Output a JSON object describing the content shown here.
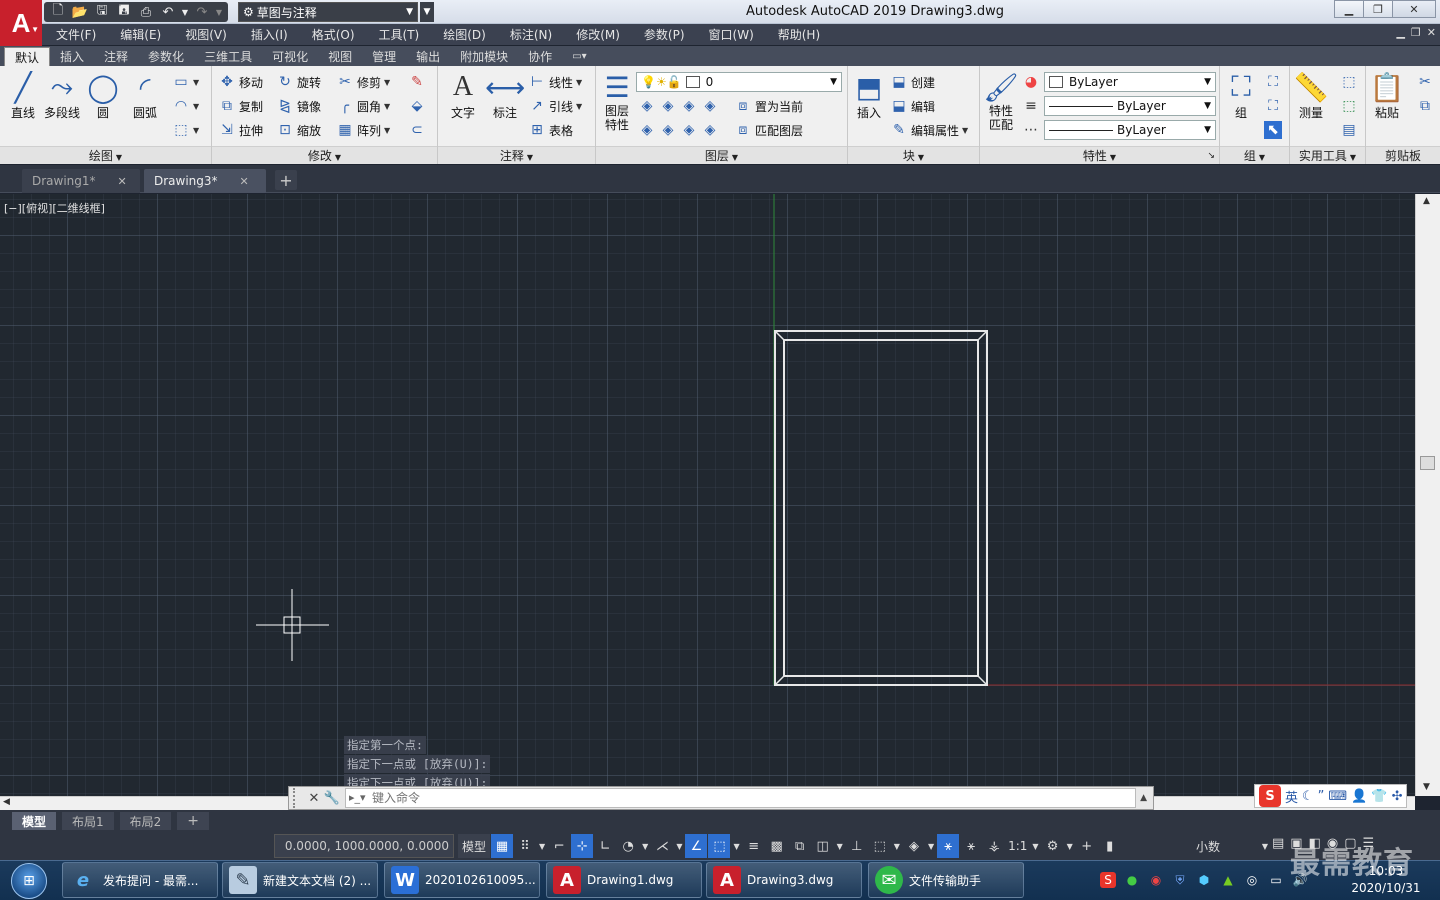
{
  "app": {
    "window_title": "Autodesk AutoCAD 2019    Drawing3.dwg",
    "logo_letter": "A",
    "workspace": "草图与注释"
  },
  "menu": [
    "文件(F)",
    "编辑(E)",
    "视图(V)",
    "插入(I)",
    "格式(O)",
    "工具(T)",
    "绘图(D)",
    "标注(N)",
    "修改(M)",
    "参数(P)",
    "窗口(W)",
    "帮助(H)"
  ],
  "ribbon_tabs": [
    "默认",
    "插入",
    "注释",
    "参数化",
    "三维工具",
    "可视化",
    "视图",
    "管理",
    "输出",
    "附加模块",
    "协作"
  ],
  "ribbon": {
    "draw": {
      "title": "绘图",
      "line": "直线",
      "polyline": "多段线",
      "circle": "圆",
      "arc": "圆弧"
    },
    "modify": {
      "title": "修改",
      "move": "移动",
      "rotate": "旋转",
      "trim": "修剪",
      "copy": "复制",
      "mirror": "镜像",
      "fillet": "圆角",
      "stretch": "拉伸",
      "scale": "缩放",
      "array": "阵列"
    },
    "annotation": {
      "title": "注释",
      "text": "文字",
      "dimension": "标注",
      "linear": "线性",
      "leader": "引线",
      "table": "表格"
    },
    "layers": {
      "title": "图层",
      "props_l1": "图层",
      "props_l2": "特性",
      "current_layer": "0",
      "set_current": "置为当前",
      "match_layer": "匹配图层"
    },
    "block": {
      "title": "块",
      "insert": "插入",
      "create": "创建",
      "edit": "编辑",
      "edit_attr": "编辑属性"
    },
    "properties": {
      "title": "特性",
      "match_l1": "特性",
      "match_l2": "匹配",
      "color": "ByLayer",
      "linetype": "ByLayer",
      "lineweight": "ByLayer"
    },
    "groups": {
      "title": "组",
      "group": "组"
    },
    "utilities": {
      "title": "实用工具",
      "measure": "测量"
    },
    "clipboard": {
      "title": "剪贴板",
      "paste": "粘贴"
    }
  },
  "file_tabs": [
    {
      "label": "Drawing1*"
    },
    {
      "label": "Drawing3*"
    }
  ],
  "viewport_label": "[−][俯视][二维线框]",
  "command_history": [
    "指定第一个点:",
    "指定下一点或 [放弃(U)]:",
    "指定下一点或 [放弃(U)]:"
  ],
  "command_placeholder": "键入命令",
  "layout_tabs": [
    "模型",
    "布局1",
    "布局2"
  ],
  "status": {
    "coords": "0.0000, 1000.0000, 0.0000",
    "model": "模型",
    "scale": "1:1",
    "units": "小数"
  },
  "ime": {
    "lang": "英"
  },
  "taskbar": [
    {
      "label": "发布提问 - 最需...",
      "icon": "ie-icon",
      "color": "#3a8ee6"
    },
    {
      "label": "新建文本文档 (2) ...",
      "icon": "notepad-icon",
      "color": "#8aa8c8"
    },
    {
      "label": "2020102610095...",
      "icon": "word-icon",
      "color": "#2b6fd6"
    },
    {
      "label": "Drawing1.dwg",
      "icon": "autocad-icon",
      "color": "#c8202c"
    },
    {
      "label": "Drawing3.dwg",
      "icon": "autocad-icon",
      "color": "#c8202c"
    },
    {
      "label": "文件传输助手",
      "icon": "wechat-icon",
      "color": "#2fb84a"
    }
  ],
  "clock": {
    "time": "10:03",
    "date": "2020/10/31"
  },
  "watermark": "最需教育",
  "colors": {
    "canvas": "#212830",
    "accent": "#2e6fd0",
    "autocad_red": "#c8202c"
  }
}
